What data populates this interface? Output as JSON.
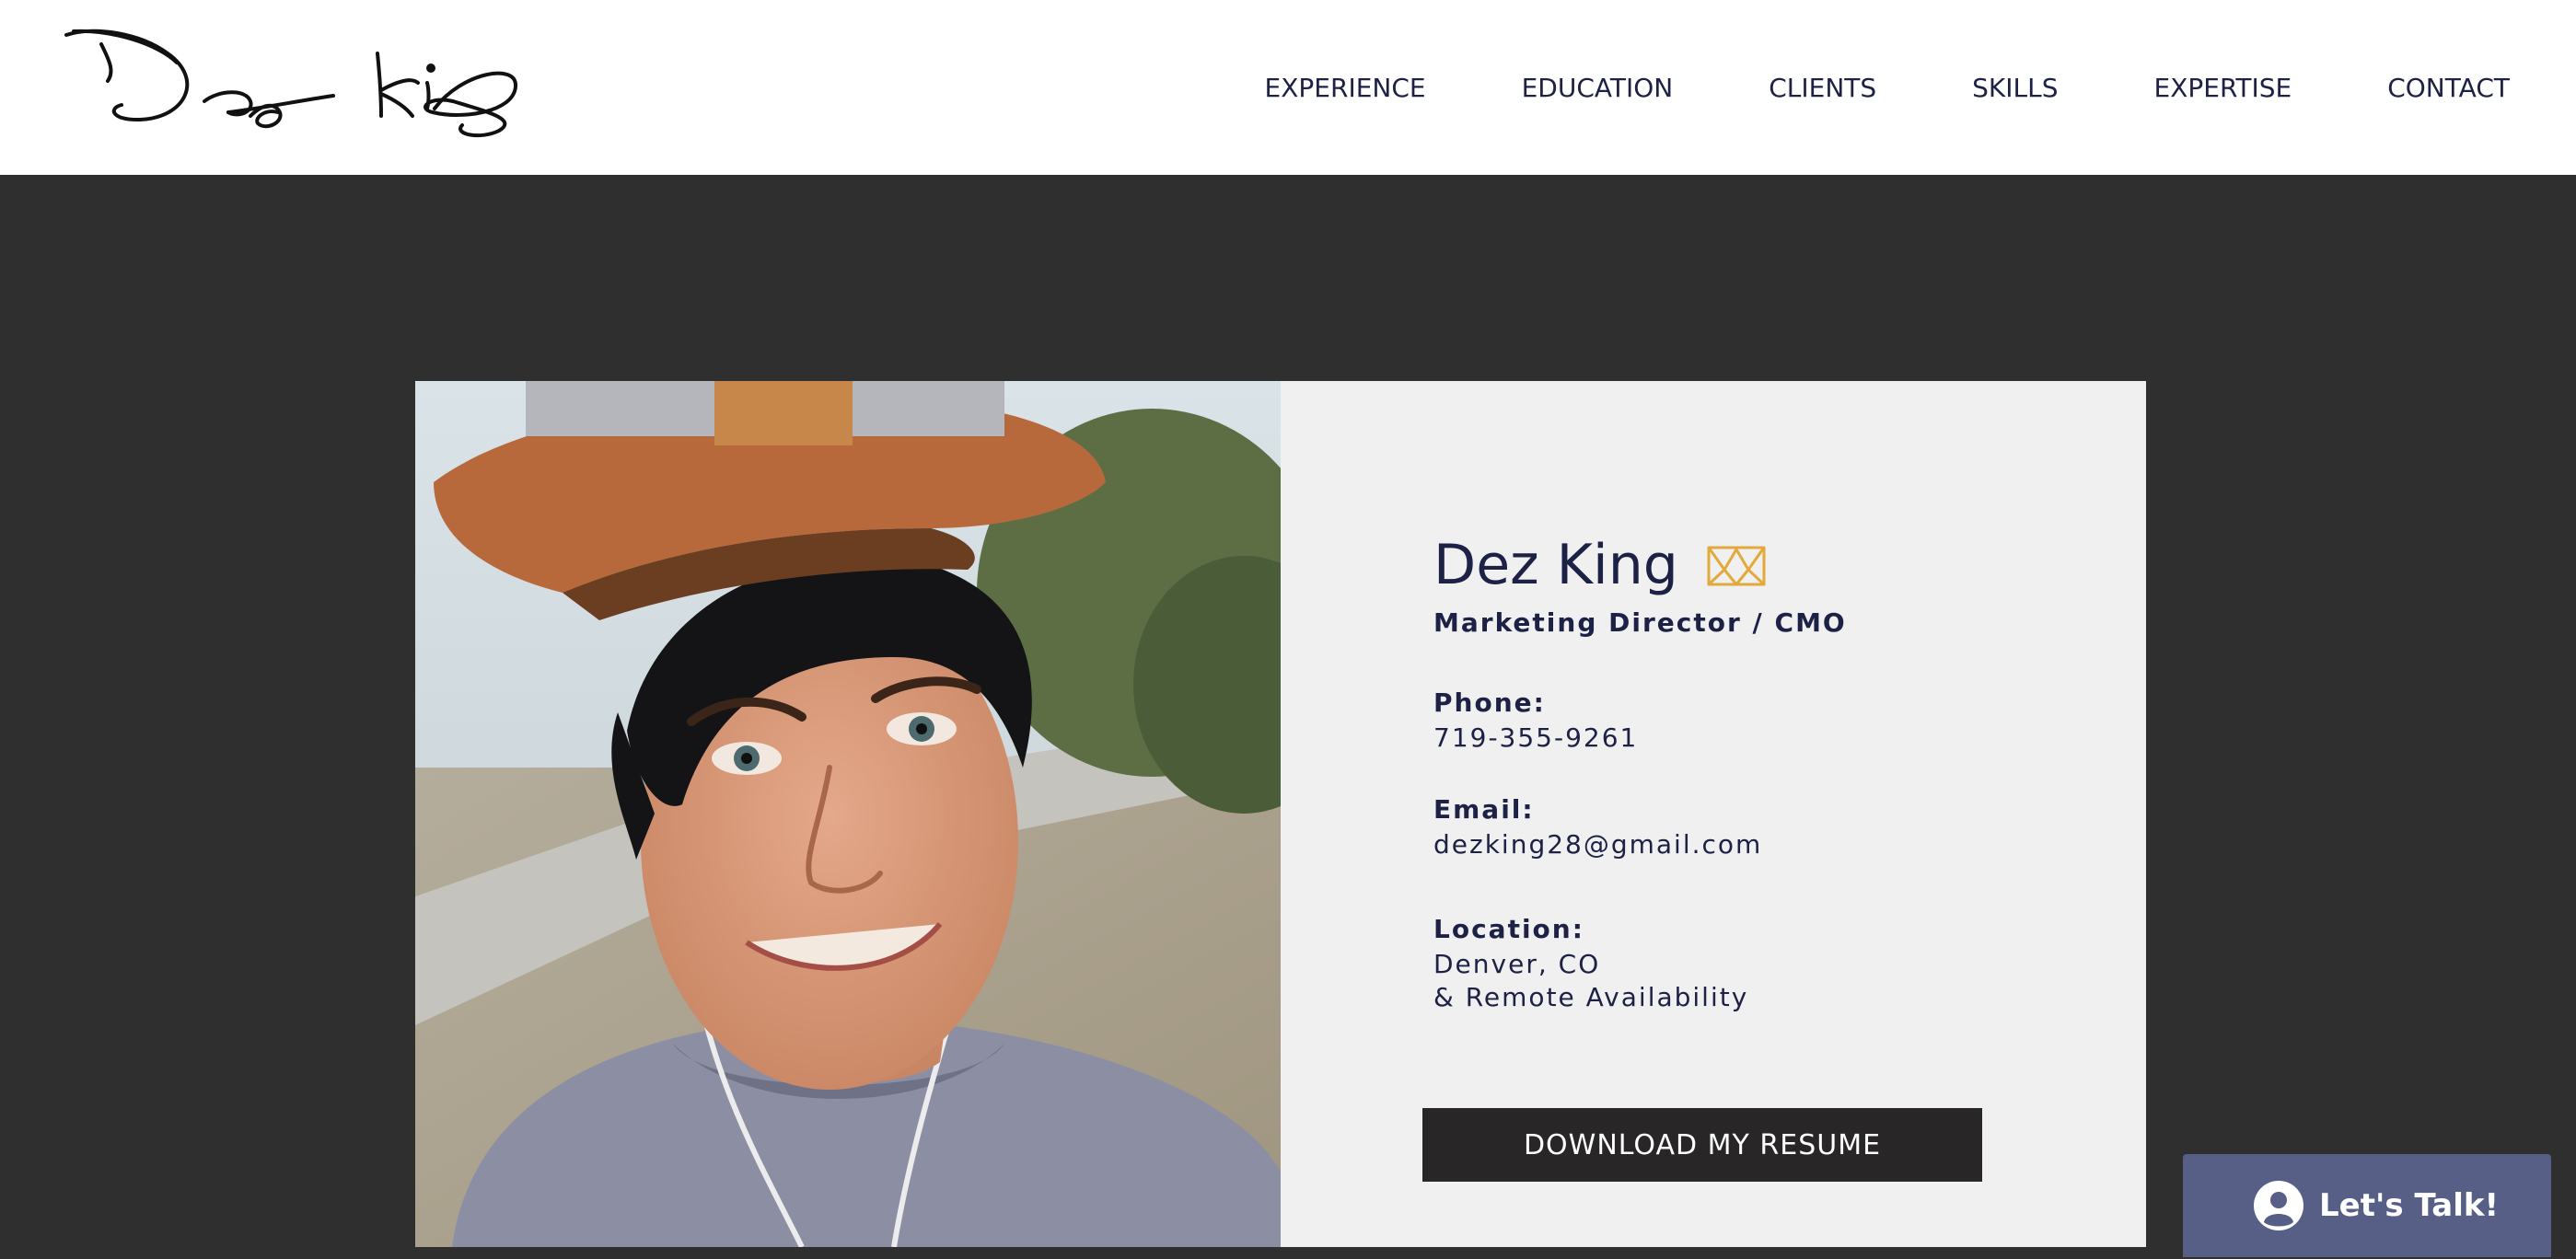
{
  "header": {
    "logo_text": "Dez King",
    "nav": [
      {
        "label": "EXPERIENCE"
      },
      {
        "label": "EDUCATION"
      },
      {
        "label": "CLIENTS"
      },
      {
        "label": "SKILLS"
      },
      {
        "label": "EXPERTISE"
      },
      {
        "label": "CONTACT"
      }
    ]
  },
  "profile": {
    "name": "Dez King",
    "title": "Marketing Director / CMO",
    "phone_label": "Phone:",
    "phone": "719-355-9261",
    "email_label": "Email:",
    "email": "dezking28@gmail.com",
    "location_label": "Location:",
    "location_line1": "Denver, CO",
    "location_line2": "& Remote Availability",
    "download_label": "DOWNLOAD MY RESUME",
    "crown_icon": "crown-icon",
    "accent_color": "#e2a93b"
  },
  "chat": {
    "label": "Let's Talk!",
    "icon": "user-avatar-icon",
    "color": "#575f86"
  },
  "colors": {
    "navy": "#1d2145",
    "background": "#2f2f2f",
    "card": "#f0f0f0",
    "button": "#282626"
  }
}
